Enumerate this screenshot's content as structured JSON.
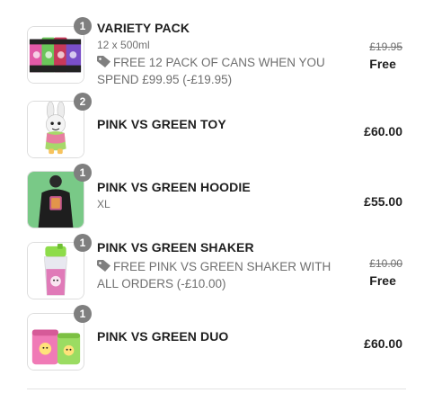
{
  "items": [
    {
      "name": "VARIETY PACK",
      "quantity": "1",
      "variant": "12 x 500ml",
      "discount": "FREE 12 PACK OF CANS WHEN YOU SPEND £99.95 (-£19.95)",
      "original_price": "£19.95",
      "price": "Free",
      "image": "variety-pack-cans-image"
    },
    {
      "name": "PINK VS GREEN TOY",
      "quantity": "2",
      "price": "£60.00",
      "image": "pink-vs-green-toy-image"
    },
    {
      "name": "PINK VS GREEN HOODIE",
      "quantity": "1",
      "variant": "XL",
      "price": "£55.00",
      "image": "pink-vs-green-hoodie-image"
    },
    {
      "name": "PINK VS GREEN SHAKER",
      "quantity": "1",
      "discount": "FREE PINK VS GREEN SHAKER WITH ALL ORDERS (-£10.00)",
      "original_price": "£10.00",
      "price": "Free",
      "image": "pink-vs-green-shaker-image"
    },
    {
      "name": "PINK VS GREEN DUO",
      "quantity": "1",
      "price": "£60.00",
      "image": "pink-vs-green-duo-image"
    }
  ],
  "icons": {
    "discount": "tag-icon"
  },
  "colors": {
    "badge": "#7f7f7f",
    "text": "#1f1f1f",
    "muted": "#707070"
  }
}
